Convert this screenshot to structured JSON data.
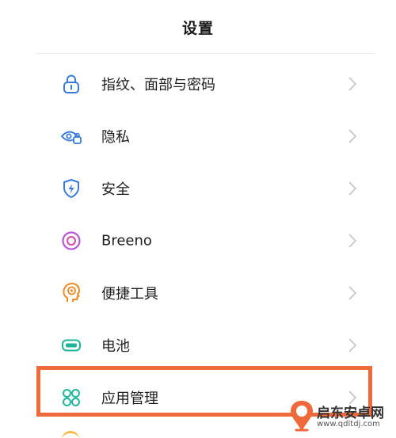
{
  "header": {
    "title": "设置"
  },
  "settings_items": [
    {
      "label": "指纹、面部与密码",
      "icon": "lock-icon",
      "color": "#3a7ad9"
    },
    {
      "label": "隐私",
      "icon": "privacy-eye-lock-icon",
      "color": "#3a7ad9"
    },
    {
      "label": "安全",
      "icon": "shield-bolt-icon",
      "color": "#3a7ad9"
    },
    {
      "label": "Breeno",
      "icon": "breeno-ring-icon",
      "color": "#b35ad8"
    },
    {
      "label": "便捷工具",
      "icon": "smart-tools-head-icon",
      "color": "#f08a24"
    },
    {
      "label": "电池",
      "icon": "battery-icon",
      "color": "#1fb59a"
    },
    {
      "label": "应用管理",
      "icon": "app-grid-icon",
      "color": "#1fb59a"
    }
  ],
  "highlight": {
    "color": "#ef6a3b",
    "target": "应用管理"
  },
  "watermark": {
    "name": "启东安卓网",
    "url": "www.qdltdj.com",
    "color": "#ef6a3b"
  }
}
